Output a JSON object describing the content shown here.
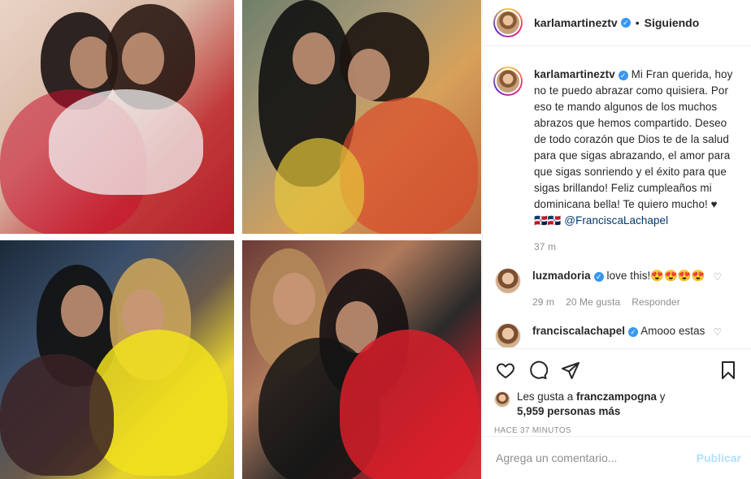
{
  "header": {
    "username": "karlamartineztv",
    "separator": "•",
    "follow_status": "Siguiendo"
  },
  "caption": {
    "username": "karlamartineztv",
    "text": "Mi Fran querida, hoy no te puedo abrazar como quisiera. Por eso te mando algunos de los muchos abrazos que hemos compartido. Deseo de todo corazón que Dios te de la salud para que sigas abrazando, el amor para que sigas sonriendo y el éxito para que sigas brillando! Feliz cumpleaños mi dominicana bella! Te quiero mucho! ♥",
    "flags": "🇩🇴🇩🇴",
    "mention": "@FranciscaLachapel",
    "time": "37 m"
  },
  "comments": [
    {
      "username": "luzmadoria",
      "text": "love this!😍😍😍😍",
      "time": "29 m",
      "likes": "20 Me gusta",
      "reply": "Responder"
    },
    {
      "username": "franciscalachapel",
      "text": "Amooo estas"
    }
  ],
  "icons": {
    "like": "heart-icon",
    "comment": "comment-icon",
    "share": "share-icon",
    "save": "bookmark-icon",
    "comment_like": "♡"
  },
  "likes": {
    "prefix": "Les gusta a",
    "user": "franczampogna",
    "joiner": "y",
    "others": "5,959 personas más"
  },
  "timestamp": "HACE 37 MINUTOS",
  "add_comment": {
    "placeholder": "Agrega un comentario...",
    "post_label": "Publicar"
  },
  "colors": {
    "verified": "#3897f0",
    "post_disabled": "#b2dffc",
    "heart": "#a3141e"
  }
}
